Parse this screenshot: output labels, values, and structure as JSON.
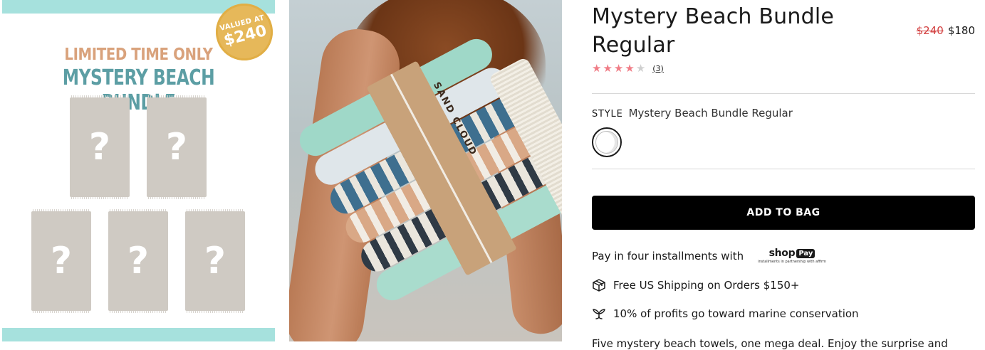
{
  "promo_image": {
    "seal_line1": "VALUED AT",
    "seal_line2": "$240",
    "headline1": "LIMITED TIME ONLY",
    "headline2": "MYSTERY BEACH BUNDLE",
    "towel_mark": "?",
    "towel_count": 5,
    "colors": {
      "band": "#a6e1dd",
      "headline1": "#d9a27c",
      "headline2": "#5c9ea4",
      "towel": "#cfcac3",
      "seal": "#e6b85a"
    }
  },
  "photo": {
    "description_icon": "product-photo",
    "brand_text": "SAND CLOUD"
  },
  "product": {
    "title": "Mystery Beach Bundle Regular",
    "price_original": "$240",
    "price_sale": "$180",
    "rating": {
      "value": 4,
      "max": 5,
      "count_label": "(3)"
    },
    "style_label": "STYLE",
    "style_value": "Mystery Beach Bundle Regular",
    "add_to_bag_label": "ADD TO BAG",
    "installments_text": "Pay in four installments with",
    "shoppay": {
      "shop": "shop",
      "pay": "Pay",
      "sub": "installments in partnership with affirm"
    },
    "features": [
      {
        "icon": "box-icon",
        "text": "Free US Shipping on Orders $150+"
      },
      {
        "icon": "whale-tail-icon",
        "text": "10% of profits go toward marine conservation"
      }
    ],
    "description": "Five mystery beach towels, one mega deal. Enjoy the surprise and"
  },
  "colors": {
    "sale_price": "#d23f3f",
    "star_on": "#f07c86",
    "star_off": "#cfcfcf",
    "button": "#000000"
  }
}
